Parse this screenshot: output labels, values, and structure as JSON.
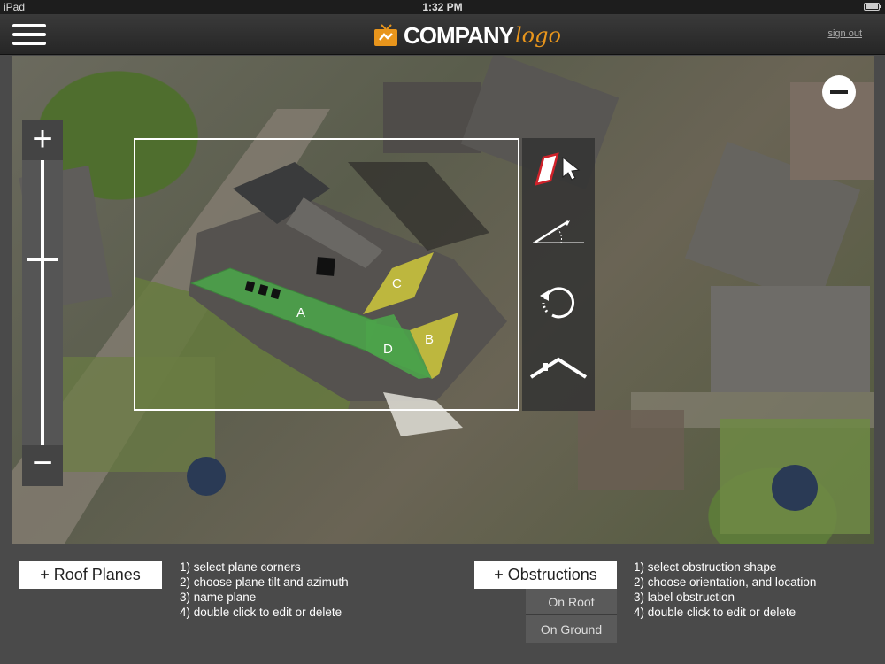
{
  "status_bar": {
    "device": "iPad",
    "time": "1:32 PM"
  },
  "header": {
    "logo_main": "COMPANY",
    "logo_script": "logo",
    "sign_out": "sign out"
  },
  "map": {
    "zoom_in": "+",
    "zoom_out": "−",
    "planes": [
      {
        "label": "A",
        "color": "#4ca34a"
      },
      {
        "label": "B",
        "color": "#c9c23c"
      },
      {
        "label": "C",
        "color": "#c9c23c"
      },
      {
        "label": "D",
        "color": "#4ca34a"
      }
    ],
    "tools": [
      "plane-select-icon",
      "tilt-angle-icon",
      "rotate-icon",
      "roof-icon"
    ]
  },
  "roof_planes": {
    "button": "+ Roof Planes",
    "steps": [
      "1) select plane corners",
      "2) choose plane tilt and azimuth",
      "3) name plane",
      "4) double click to edit or delete"
    ]
  },
  "obstructions": {
    "button": "+ Obstructions",
    "options": [
      "On Roof",
      "On Ground"
    ],
    "steps": [
      "1) select obstruction shape",
      "2) choose orientation, and location",
      "3) label obstruction",
      "4) double click to edit or delete"
    ]
  },
  "colors": {
    "accent": "#e8951c",
    "plane_green": "#4ca34a",
    "plane_yellow": "#c9c23c",
    "tool_red": "#d0222a"
  }
}
